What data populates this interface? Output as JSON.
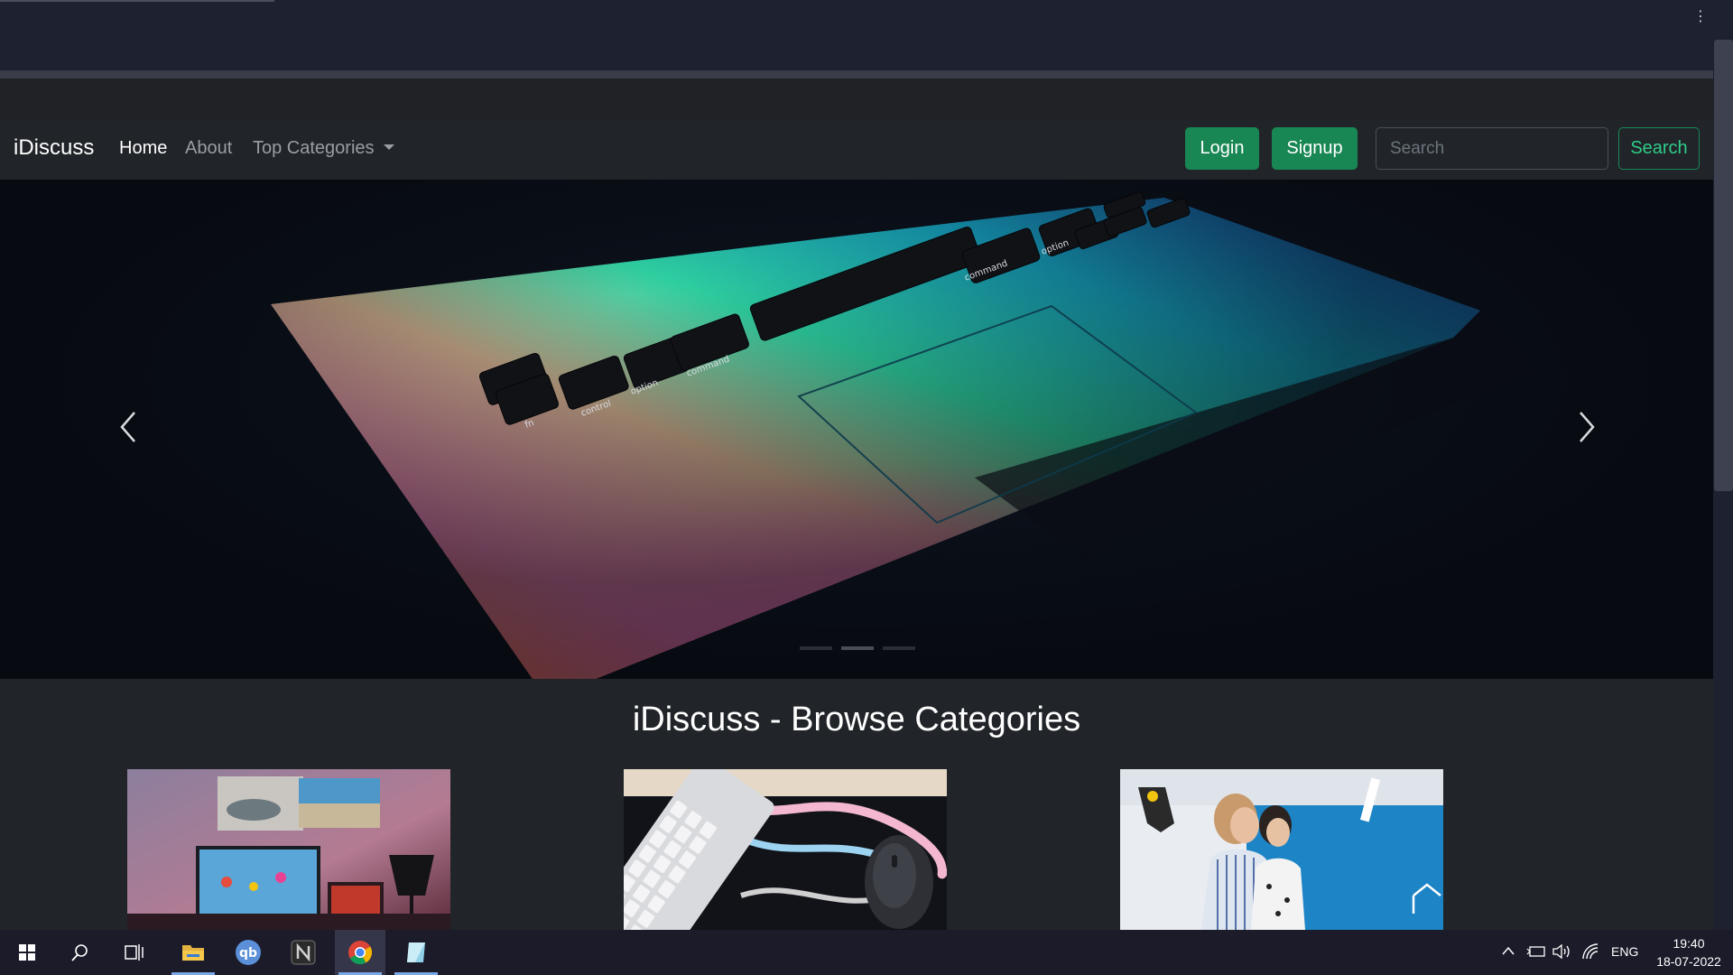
{
  "browser": {
    "menu_icon": "vertical-ellipsis-icon"
  },
  "navbar": {
    "brand": "iDiscuss",
    "links": [
      {
        "label": "Home",
        "active": true
      },
      {
        "label": "About",
        "active": false
      },
      {
        "label": "Top Categories",
        "dropdown": true
      }
    ],
    "login_label": "Login",
    "signup_label": "Signup",
    "search_placeholder": "Search",
    "search_button_label": "Search",
    "accent_color": "#198754"
  },
  "carousel": {
    "image_subject": "laptop keyboard with rainbow gradient lighting",
    "keys": [
      "fn",
      "control",
      "option",
      "command",
      "command",
      "option"
    ],
    "prev_icon": "chevron-left-icon",
    "next_icon": "chevron-right-icon",
    "indicator_count": 3,
    "active_indicator": 2
  },
  "main": {
    "title": "iDiscuss - Browse Categories",
    "cards": [
      {
        "image_subject": "desk setup with monitor and lamp"
      },
      {
        "image_subject": "keyboard and mouse on colorful desk mat"
      },
      {
        "image_subject": "two people in a lab"
      }
    ]
  },
  "taskbar": {
    "apps": [
      {
        "name": "start-icon"
      },
      {
        "name": "search-icon"
      },
      {
        "name": "task-view-icon"
      },
      {
        "name": "file-explorer-icon"
      },
      {
        "name": "qbittorrent-icon"
      },
      {
        "name": "notion-icon"
      },
      {
        "name": "chrome-icon"
      },
      {
        "name": "app-icon"
      }
    ],
    "language": "ENG",
    "time": "19:40",
    "date": "18-07-2022"
  }
}
